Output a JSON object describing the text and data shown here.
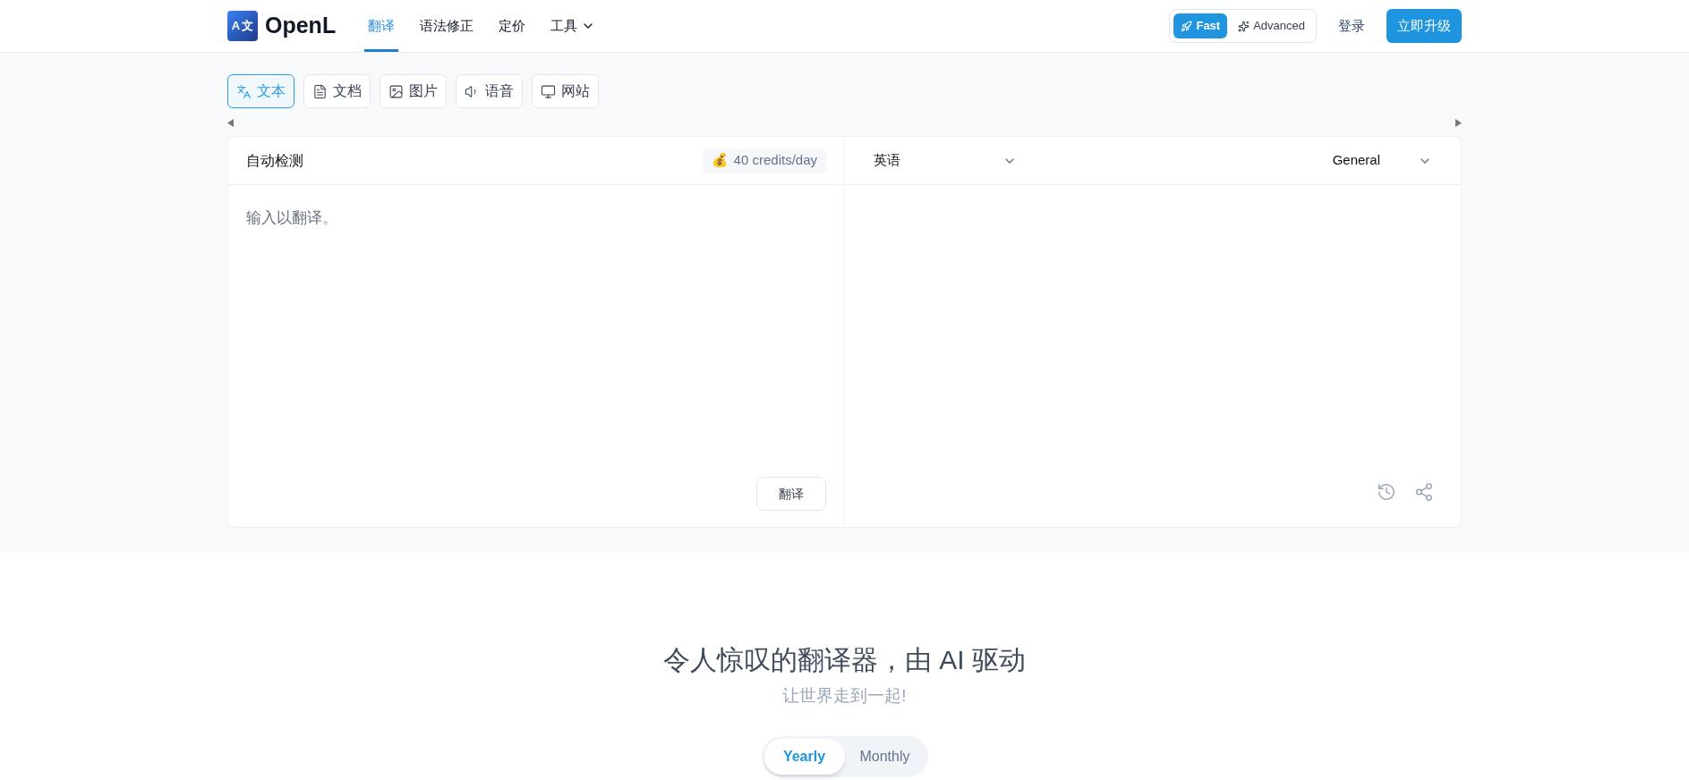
{
  "logo": {
    "mark": [
      "A",
      "文"
    ],
    "name": "OpenL"
  },
  "nav": [
    {
      "label": "翻译",
      "selected": true,
      "kind": "link"
    },
    {
      "label": "语法修正",
      "selected": false,
      "kind": "link"
    },
    {
      "label": "定价",
      "selected": false,
      "kind": "link"
    },
    {
      "label": "工具",
      "selected": false,
      "kind": "menu"
    }
  ],
  "mode_toggle": [
    {
      "label": "Fast",
      "selected": true,
      "kind": "fast"
    },
    {
      "label": "Advanced",
      "selected": false,
      "kind": "advanced"
    }
  ],
  "login": "登录",
  "upgrade": "立即升级",
  "input_tabs": [
    {
      "label": "文本",
      "selected": true,
      "kind": "text"
    },
    {
      "label": "文档",
      "selected": false,
      "kind": "document"
    },
    {
      "label": "图片",
      "selected": false,
      "kind": "image"
    },
    {
      "label": "语音",
      "selected": false,
      "kind": "audio"
    },
    {
      "label": "网站",
      "selected": false,
      "kind": "website"
    }
  ],
  "source": {
    "language": "自动检测",
    "credits": "40 credits/day",
    "credits_icon": "💰",
    "placeholder": "输入以翻译。",
    "button": "翻译"
  },
  "target": {
    "language": "英语",
    "style": "General"
  },
  "hero": {
    "title": "令人惊叹的翻译器，由 AI 驱动",
    "subtitle": "让世界走到一起!"
  },
  "billing": [
    {
      "label": "Yearly",
      "selected": true
    },
    {
      "label": "Monthly",
      "selected": false
    }
  ]
}
